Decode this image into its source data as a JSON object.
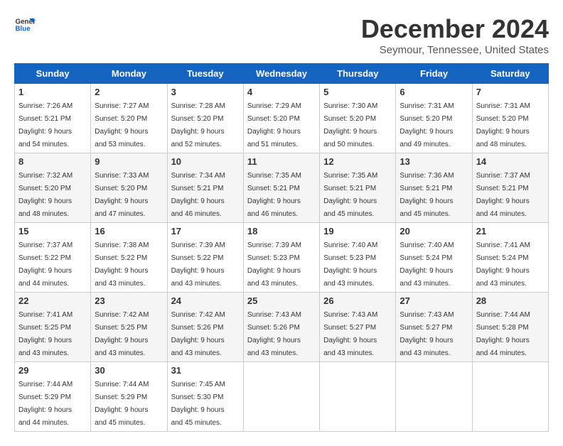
{
  "logo": {
    "line1": "General",
    "line2": "Blue"
  },
  "title": "December 2024",
  "location": "Seymour, Tennessee, United States",
  "days_of_week": [
    "Sunday",
    "Monday",
    "Tuesday",
    "Wednesday",
    "Thursday",
    "Friday",
    "Saturday"
  ],
  "weeks": [
    [
      {
        "day": "1",
        "sunrise": "7:26 AM",
        "sunset": "5:21 PM",
        "daylight_hours": "9",
        "daylight_minutes": "54"
      },
      {
        "day": "2",
        "sunrise": "7:27 AM",
        "sunset": "5:20 PM",
        "daylight_hours": "9",
        "daylight_minutes": "53"
      },
      {
        "day": "3",
        "sunrise": "7:28 AM",
        "sunset": "5:20 PM",
        "daylight_hours": "9",
        "daylight_minutes": "52"
      },
      {
        "day": "4",
        "sunrise": "7:29 AM",
        "sunset": "5:20 PM",
        "daylight_hours": "9",
        "daylight_minutes": "51"
      },
      {
        "day": "5",
        "sunrise": "7:30 AM",
        "sunset": "5:20 PM",
        "daylight_hours": "9",
        "daylight_minutes": "50"
      },
      {
        "day": "6",
        "sunrise": "7:31 AM",
        "sunset": "5:20 PM",
        "daylight_hours": "9",
        "daylight_minutes": "49"
      },
      {
        "day": "7",
        "sunrise": "7:31 AM",
        "sunset": "5:20 PM",
        "daylight_hours": "9",
        "daylight_minutes": "48"
      }
    ],
    [
      {
        "day": "8",
        "sunrise": "7:32 AM",
        "sunset": "5:20 PM",
        "daylight_hours": "9",
        "daylight_minutes": "48"
      },
      {
        "day": "9",
        "sunrise": "7:33 AM",
        "sunset": "5:20 PM",
        "daylight_hours": "9",
        "daylight_minutes": "47"
      },
      {
        "day": "10",
        "sunrise": "7:34 AM",
        "sunset": "5:21 PM",
        "daylight_hours": "9",
        "daylight_minutes": "46"
      },
      {
        "day": "11",
        "sunrise": "7:35 AM",
        "sunset": "5:21 PM",
        "daylight_hours": "9",
        "daylight_minutes": "46"
      },
      {
        "day": "12",
        "sunrise": "7:35 AM",
        "sunset": "5:21 PM",
        "daylight_hours": "9",
        "daylight_minutes": "45"
      },
      {
        "day": "13",
        "sunrise": "7:36 AM",
        "sunset": "5:21 PM",
        "daylight_hours": "9",
        "daylight_minutes": "45"
      },
      {
        "day": "14",
        "sunrise": "7:37 AM",
        "sunset": "5:21 PM",
        "daylight_hours": "9",
        "daylight_minutes": "44"
      }
    ],
    [
      {
        "day": "15",
        "sunrise": "7:37 AM",
        "sunset": "5:22 PM",
        "daylight_hours": "9",
        "daylight_minutes": "44"
      },
      {
        "day": "16",
        "sunrise": "7:38 AM",
        "sunset": "5:22 PM",
        "daylight_hours": "9",
        "daylight_minutes": "43"
      },
      {
        "day": "17",
        "sunrise": "7:39 AM",
        "sunset": "5:22 PM",
        "daylight_hours": "9",
        "daylight_minutes": "43"
      },
      {
        "day": "18",
        "sunrise": "7:39 AM",
        "sunset": "5:23 PM",
        "daylight_hours": "9",
        "daylight_minutes": "43"
      },
      {
        "day": "19",
        "sunrise": "7:40 AM",
        "sunset": "5:23 PM",
        "daylight_hours": "9",
        "daylight_minutes": "43"
      },
      {
        "day": "20",
        "sunrise": "7:40 AM",
        "sunset": "5:24 PM",
        "daylight_hours": "9",
        "daylight_minutes": "43"
      },
      {
        "day": "21",
        "sunrise": "7:41 AM",
        "sunset": "5:24 PM",
        "daylight_hours": "9",
        "daylight_minutes": "43"
      }
    ],
    [
      {
        "day": "22",
        "sunrise": "7:41 AM",
        "sunset": "5:25 PM",
        "daylight_hours": "9",
        "daylight_minutes": "43"
      },
      {
        "day": "23",
        "sunrise": "7:42 AM",
        "sunset": "5:25 PM",
        "daylight_hours": "9",
        "daylight_minutes": "43"
      },
      {
        "day": "24",
        "sunrise": "7:42 AM",
        "sunset": "5:26 PM",
        "daylight_hours": "9",
        "daylight_minutes": "43"
      },
      {
        "day": "25",
        "sunrise": "7:43 AM",
        "sunset": "5:26 PM",
        "daylight_hours": "9",
        "daylight_minutes": "43"
      },
      {
        "day": "26",
        "sunrise": "7:43 AM",
        "sunset": "5:27 PM",
        "daylight_hours": "9",
        "daylight_minutes": "43"
      },
      {
        "day": "27",
        "sunrise": "7:43 AM",
        "sunset": "5:27 PM",
        "daylight_hours": "9",
        "daylight_minutes": "43"
      },
      {
        "day": "28",
        "sunrise": "7:44 AM",
        "sunset": "5:28 PM",
        "daylight_hours": "9",
        "daylight_minutes": "44"
      }
    ],
    [
      {
        "day": "29",
        "sunrise": "7:44 AM",
        "sunset": "5:29 PM",
        "daylight_hours": "9",
        "daylight_minutes": "44"
      },
      {
        "day": "30",
        "sunrise": "7:44 AM",
        "sunset": "5:29 PM",
        "daylight_hours": "9",
        "daylight_minutes": "45"
      },
      {
        "day": "31",
        "sunrise": "7:45 AM",
        "sunset": "5:30 PM",
        "daylight_hours": "9",
        "daylight_minutes": "45"
      },
      null,
      null,
      null,
      null
    ]
  ]
}
